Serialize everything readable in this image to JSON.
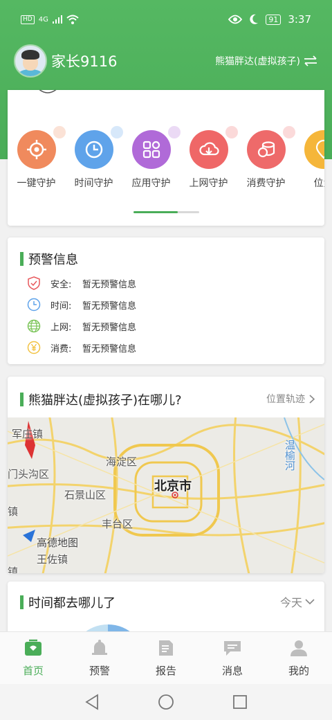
{
  "status_bar": {
    "left_badge": "HD",
    "signal": "4G",
    "battery": "91",
    "time": "3:37"
  },
  "header": {
    "parent_name": "家长9116",
    "child_name": "熊猫胖达(虚拟孩子)"
  },
  "functions": [
    {
      "label": "一键守护",
      "icon": "target-icon",
      "color": "#f08a5d"
    },
    {
      "label": "时间守护",
      "icon": "clock-icon",
      "color": "#5fa3ea"
    },
    {
      "label": "应用守护",
      "icon": "apps-grid-icon",
      "color": "#b06ad8"
    },
    {
      "label": "上网守护",
      "icon": "cloud-download-icon",
      "color": "#ef6767"
    },
    {
      "label": "消费守护",
      "icon": "coins-icon",
      "color": "#ee6a6a"
    },
    {
      "label": "位置",
      "icon": "location-icon",
      "color": "#f5b63a"
    }
  ],
  "warning": {
    "title": "预警信息",
    "rows": [
      {
        "key": "安全:",
        "value": "暂无预警信息",
        "icon": "shield-icon",
        "color": "#e8585c"
      },
      {
        "key": "时间:",
        "value": "暂无预警信息",
        "icon": "clock-icon",
        "color": "#5fa3ea"
      },
      {
        "key": "上网:",
        "value": "暂无预警信息",
        "icon": "globe-icon",
        "color": "#7cc55a"
      },
      {
        "key": "消费:",
        "value": "暂无预警信息",
        "icon": "yuan-icon",
        "color": "#f2c242"
      }
    ]
  },
  "location": {
    "title": "熊猫胖达(虚拟孩子)在哪儿?",
    "track_link": "位置轨迹",
    "map_labels": [
      "军庄镇",
      "海淀区",
      "门头沟区",
      "石景山区",
      "北京市",
      "温榆河",
      "镇",
      "丰台区",
      "高德地图",
      "王佐镇",
      "镇"
    ]
  },
  "time_section": {
    "title": "时间都去哪儿了",
    "period": "今天"
  },
  "tabs": [
    {
      "label": "首页",
      "icon": "home-icon",
      "active": true
    },
    {
      "label": "预警",
      "icon": "bell-icon",
      "active": false
    },
    {
      "label": "报告",
      "icon": "report-icon",
      "active": false
    },
    {
      "label": "消息",
      "icon": "message-icon",
      "active": false
    },
    {
      "label": "我的",
      "icon": "user-icon",
      "active": false
    }
  ],
  "colors": {
    "brand_green": "#4aad58",
    "header_green": "#55b862"
  }
}
